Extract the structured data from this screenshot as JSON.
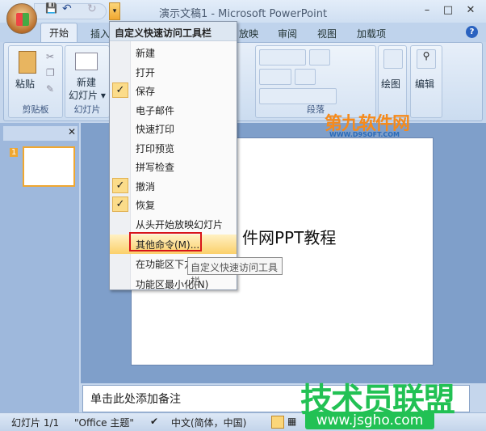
{
  "window": {
    "title": "演示文稿1 - Microsoft PowerPoint",
    "minimize": "–",
    "maximize": "□",
    "close": "✕"
  },
  "qat": {
    "save_icon": "💾",
    "undo_icon": "↶",
    "redo_icon": "↻",
    "dropdown": "▾"
  },
  "tabs": [
    {
      "label": "开始"
    },
    {
      "label": "插入"
    },
    {
      "label": "放映"
    },
    {
      "label": "审阅"
    },
    {
      "label": "视图"
    },
    {
      "label": "加载项"
    }
  ],
  "help": "?",
  "ribbon": {
    "clipboard": {
      "label": "剪贴板",
      "paste": "粘贴"
    },
    "slides": {
      "label": "幻灯片",
      "new_slide_1": "新建",
      "new_slide_2": "幻灯片 ▾"
    },
    "paragraph": {
      "label": "段落"
    },
    "drawing": {
      "label": "绘图"
    },
    "editing": {
      "label": "编辑"
    }
  },
  "menu": {
    "header": "自定义快速访问工具栏",
    "items": [
      {
        "label": "新建",
        "checked": false
      },
      {
        "label": "打开",
        "checked": false
      },
      {
        "label": "保存",
        "checked": true
      },
      {
        "label": "电子邮件",
        "checked": false
      },
      {
        "label": "快速打印",
        "checked": false
      },
      {
        "label": "打印预览",
        "checked": false
      },
      {
        "label": "拼写检查",
        "checked": false
      },
      {
        "label": "撤消",
        "checked": true
      },
      {
        "label": "恢复",
        "checked": true
      },
      {
        "label": "从头开始放映幻灯片",
        "checked": false
      },
      {
        "label": "其他命令(M)...",
        "checked": false,
        "highlighted": true
      },
      {
        "label": "在功能区下方显示(S)",
        "checked": false
      },
      {
        "label": "功能区最小化(N)",
        "checked": false
      }
    ],
    "check_mark": "✓"
  },
  "tooltip": "自定义快速访问工具栏",
  "slide": {
    "title_text": "件网PPT教程",
    "thumb_number": "1"
  },
  "notes": {
    "placeholder": "单击此处添加备注"
  },
  "status": {
    "slide": "幻灯片 1/1",
    "theme": "\"Office 主题\"",
    "language": "中文(简体，中国)"
  },
  "watermarks": {
    "top": "第九软件网",
    "top_url": "WWW.D9SOFT.COM",
    "bottom": "技术员联盟",
    "bottom_url": "www.jsgho.com"
  },
  "colors": {
    "accent": "#f0a730",
    "highlight_box": "#d8141a"
  }
}
